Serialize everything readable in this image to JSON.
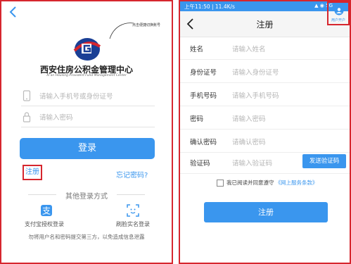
{
  "colors": {
    "accent": "#3a96ee",
    "highlight": "#d6262e"
  },
  "left": {
    "annotation": "点击便捷切换账号",
    "org_name": "西安住房公积金管理中心",
    "org_en": "Xi'an Housing Provident Fund Management Center",
    "phone_placeholder": "请输入手机号或身份证号",
    "password_placeholder": "请输入密码",
    "login_label": "登录",
    "register_link": "注册",
    "forgot_link": "忘记密码?",
    "other_login": "其他登录方式",
    "alipay_label": "支付宝授权登录",
    "face_label": "刷脸实名登录",
    "warning": "勿将用户名和密码提交第三方，以免造成信息泄露"
  },
  "right": {
    "status_time": "上午11:50 | 11.4K/s",
    "status_icons": "▲ ◉ 5G",
    "title": "注册",
    "help_label": "用户开户",
    "fields": [
      {
        "label": "姓名",
        "placeholder": "请输入姓名"
      },
      {
        "label": "身份证号",
        "placeholder": "请输入身份证号"
      },
      {
        "label": "手机号码",
        "placeholder": "请输入手机号码"
      },
      {
        "label": "密码",
        "placeholder": "请输入密码"
      },
      {
        "label": "确认密码",
        "placeholder": "请确认密码"
      },
      {
        "label": "验证码",
        "placeholder": "请输入验证码"
      }
    ],
    "send_code": "发送验证码",
    "agree_text": "我已阅读并同意遵守",
    "agree_link": "《网上服务条款》",
    "register_button": "注册"
  }
}
